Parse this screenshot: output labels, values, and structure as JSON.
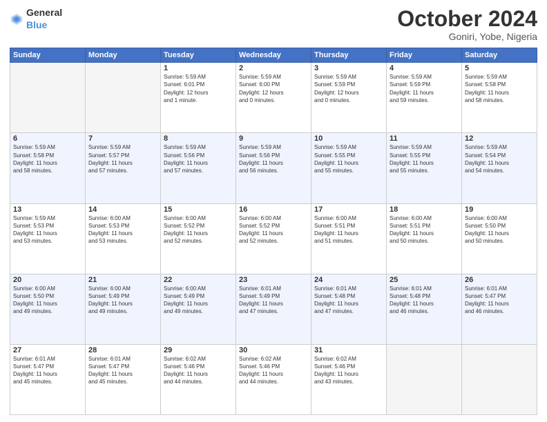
{
  "header": {
    "logo": {
      "general": "General",
      "blue": "Blue"
    },
    "title": "October 2024",
    "location": "Goniri, Yobe, Nigeria"
  },
  "calendar": {
    "days_of_week": [
      "Sunday",
      "Monday",
      "Tuesday",
      "Wednesday",
      "Thursday",
      "Friday",
      "Saturday"
    ],
    "weeks": [
      [
        {
          "day": "",
          "info": ""
        },
        {
          "day": "",
          "info": ""
        },
        {
          "day": "1",
          "info": "Sunrise: 5:59 AM\nSunset: 6:01 PM\nDaylight: 12 hours\nand 1 minute."
        },
        {
          "day": "2",
          "info": "Sunrise: 5:59 AM\nSunset: 6:00 PM\nDaylight: 12 hours\nand 0 minutes."
        },
        {
          "day": "3",
          "info": "Sunrise: 5:59 AM\nSunset: 5:59 PM\nDaylight: 12 hours\nand 0 minutes."
        },
        {
          "day": "4",
          "info": "Sunrise: 5:59 AM\nSunset: 5:59 PM\nDaylight: 11 hours\nand 59 minutes."
        },
        {
          "day": "5",
          "info": "Sunrise: 5:59 AM\nSunset: 5:58 PM\nDaylight: 11 hours\nand 58 minutes."
        }
      ],
      [
        {
          "day": "6",
          "info": "Sunrise: 5:59 AM\nSunset: 5:58 PM\nDaylight: 11 hours\nand 58 minutes."
        },
        {
          "day": "7",
          "info": "Sunrise: 5:59 AM\nSunset: 5:57 PM\nDaylight: 11 hours\nand 57 minutes."
        },
        {
          "day": "8",
          "info": "Sunrise: 5:59 AM\nSunset: 5:56 PM\nDaylight: 11 hours\nand 57 minutes."
        },
        {
          "day": "9",
          "info": "Sunrise: 5:59 AM\nSunset: 5:56 PM\nDaylight: 11 hours\nand 56 minutes."
        },
        {
          "day": "10",
          "info": "Sunrise: 5:59 AM\nSunset: 5:55 PM\nDaylight: 11 hours\nand 55 minutes."
        },
        {
          "day": "11",
          "info": "Sunrise: 5:59 AM\nSunset: 5:55 PM\nDaylight: 11 hours\nand 55 minutes."
        },
        {
          "day": "12",
          "info": "Sunrise: 5:59 AM\nSunset: 5:54 PM\nDaylight: 11 hours\nand 54 minutes."
        }
      ],
      [
        {
          "day": "13",
          "info": "Sunrise: 5:59 AM\nSunset: 5:53 PM\nDaylight: 11 hours\nand 53 minutes."
        },
        {
          "day": "14",
          "info": "Sunrise: 6:00 AM\nSunset: 5:53 PM\nDaylight: 11 hours\nand 53 minutes."
        },
        {
          "day": "15",
          "info": "Sunrise: 6:00 AM\nSunset: 5:52 PM\nDaylight: 11 hours\nand 52 minutes."
        },
        {
          "day": "16",
          "info": "Sunrise: 6:00 AM\nSunset: 5:52 PM\nDaylight: 11 hours\nand 52 minutes."
        },
        {
          "day": "17",
          "info": "Sunrise: 6:00 AM\nSunset: 5:51 PM\nDaylight: 11 hours\nand 51 minutes."
        },
        {
          "day": "18",
          "info": "Sunrise: 6:00 AM\nSunset: 5:51 PM\nDaylight: 11 hours\nand 50 minutes."
        },
        {
          "day": "19",
          "info": "Sunrise: 6:00 AM\nSunset: 5:50 PM\nDaylight: 11 hours\nand 50 minutes."
        }
      ],
      [
        {
          "day": "20",
          "info": "Sunrise: 6:00 AM\nSunset: 5:50 PM\nDaylight: 11 hours\nand 49 minutes."
        },
        {
          "day": "21",
          "info": "Sunrise: 6:00 AM\nSunset: 5:49 PM\nDaylight: 11 hours\nand 49 minutes."
        },
        {
          "day": "22",
          "info": "Sunrise: 6:00 AM\nSunset: 5:49 PM\nDaylight: 11 hours\nand 49 minutes."
        },
        {
          "day": "23",
          "info": "Sunrise: 6:01 AM\nSunset: 5:49 PM\nDaylight: 11 hours\nand 47 minutes."
        },
        {
          "day": "24",
          "info": "Sunrise: 6:01 AM\nSunset: 5:48 PM\nDaylight: 11 hours\nand 47 minutes."
        },
        {
          "day": "25",
          "info": "Sunrise: 6:01 AM\nSunset: 5:48 PM\nDaylight: 11 hours\nand 46 minutes."
        },
        {
          "day": "26",
          "info": "Sunrise: 6:01 AM\nSunset: 5:47 PM\nDaylight: 11 hours\nand 46 minutes."
        }
      ],
      [
        {
          "day": "27",
          "info": "Sunrise: 6:01 AM\nSunset: 5:47 PM\nDaylight: 11 hours\nand 45 minutes."
        },
        {
          "day": "28",
          "info": "Sunrise: 6:01 AM\nSunset: 5:47 PM\nDaylight: 11 hours\nand 45 minutes."
        },
        {
          "day": "29",
          "info": "Sunrise: 6:02 AM\nSunset: 5:46 PM\nDaylight: 11 hours\nand 44 minutes."
        },
        {
          "day": "30",
          "info": "Sunrise: 6:02 AM\nSunset: 5:46 PM\nDaylight: 11 hours\nand 44 minutes."
        },
        {
          "day": "31",
          "info": "Sunrise: 6:02 AM\nSunset: 5:46 PM\nDaylight: 11 hours\nand 43 minutes."
        },
        {
          "day": "",
          "info": ""
        },
        {
          "day": "",
          "info": ""
        }
      ]
    ]
  }
}
